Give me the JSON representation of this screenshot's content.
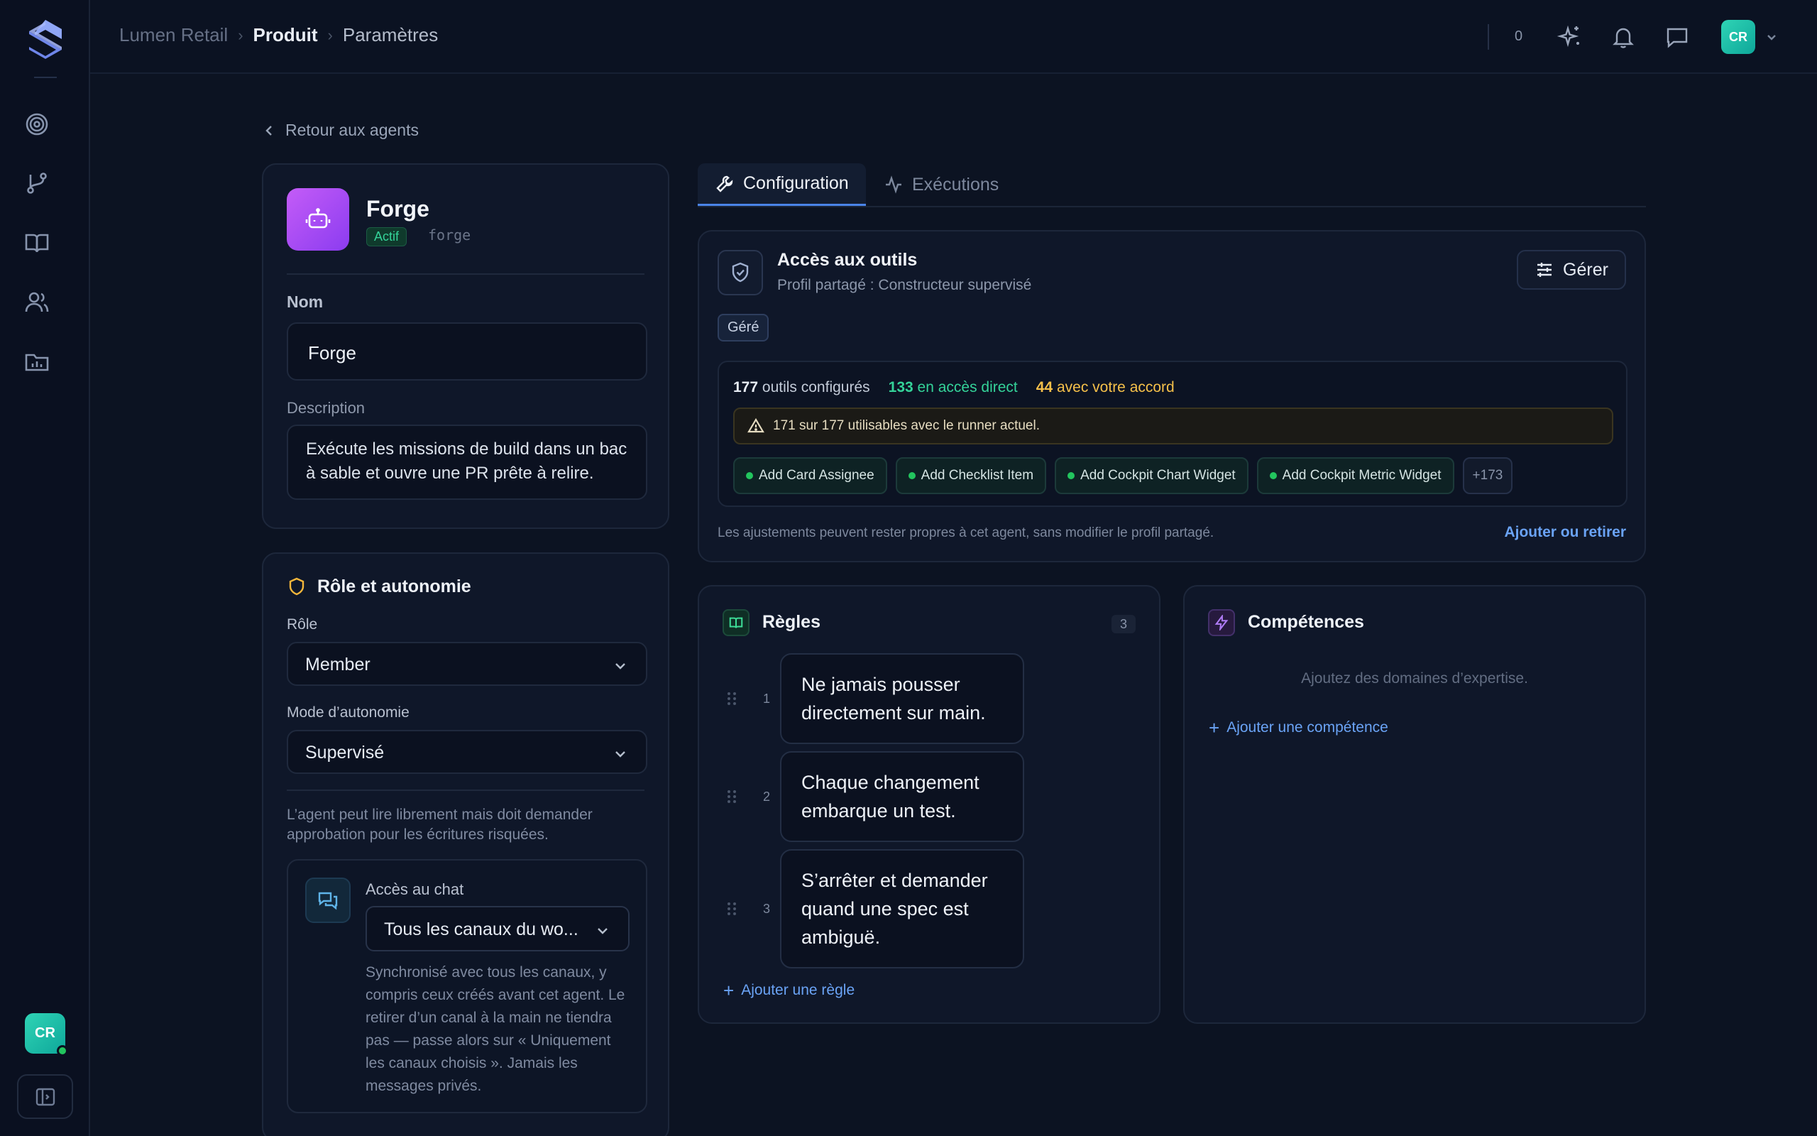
{
  "breadcrumb": {
    "org": "Lumen Retail",
    "section": "Produit",
    "page": "Paramètres"
  },
  "topbar": {
    "count": "0",
    "avatar_initials": "CR"
  },
  "sidebar": {
    "avatar_initials": "CR",
    "nav_icons": [
      "target-icon",
      "git-branch-icon",
      "book-icon",
      "users-icon",
      "folder-chart-icon"
    ]
  },
  "back_link": "Retour aux agents",
  "agent": {
    "name": "Forge",
    "status": "Actif",
    "slug": "forge",
    "name_label": "Nom",
    "name_value": "Forge",
    "description_label": "Description",
    "description_value": "Exécute les missions de build dans un bac à sable et ouvre une PR prête à relire."
  },
  "role_section": {
    "title": "Rôle et autonomie",
    "role_label": "Rôle",
    "role_value": "Member",
    "autonomy_label": "Mode d’autonomie",
    "autonomy_value": "Supervisé",
    "autonomy_note": "L’agent peut lire librement mais doit demander approbation pour les écritures risquées.",
    "chat_label": "Accès au chat",
    "chat_value": "Tous les canaux du wo...",
    "chat_note": "Synchronisé avec tous les canaux, y compris ceux créés avant cet agent. Le retirer d’un canal à la main ne tiendra pas — passe alors sur « Uniquement les canaux choisis ». Jamais les messages privés."
  },
  "tabs": [
    {
      "label": "Configuration",
      "active": true
    },
    {
      "label": "Exécutions",
      "active": false
    }
  ],
  "tools": {
    "title": "Accès aux outils",
    "subtitle": "Profil partagé : Constructeur supervisé",
    "manage_label": "Gérer",
    "badge": "Géré",
    "configured_count": "177",
    "configured_text": "outils configurés",
    "direct_count": "133",
    "direct_text": "en accès direct",
    "approval_count": "44",
    "approval_text": "avec votre accord",
    "warning": "171 sur 177 utilisables avec le runner actuel.",
    "chips": [
      "Add Card Assignee",
      "Add Checklist Item",
      "Add Cockpit Chart Widget",
      "Add Cockpit Metric Widget"
    ],
    "more": "+173",
    "footer_note": "Les ajustements peuvent rester propres à cet agent, sans modifier le profil partagé.",
    "footer_link": "Ajouter ou retirer",
    "colors": {
      "direct": "#34d399",
      "approval": "#f5c04a"
    }
  },
  "rules": {
    "title": "Règles",
    "count": "3",
    "items": [
      {
        "num": "1",
        "text": "Ne jamais pousser directement sur main."
      },
      {
        "num": "2",
        "text": "Chaque changement embarque un test."
      },
      {
        "num": "3",
        "text": "S’arrêter et demander quand une spec est ambiguë."
      }
    ],
    "add_label": "Ajouter une règle"
  },
  "skills": {
    "title": "Compétences",
    "empty_text": "Ajoutez des domaines d’expertise.",
    "add_label": "Ajouter une compétence"
  }
}
